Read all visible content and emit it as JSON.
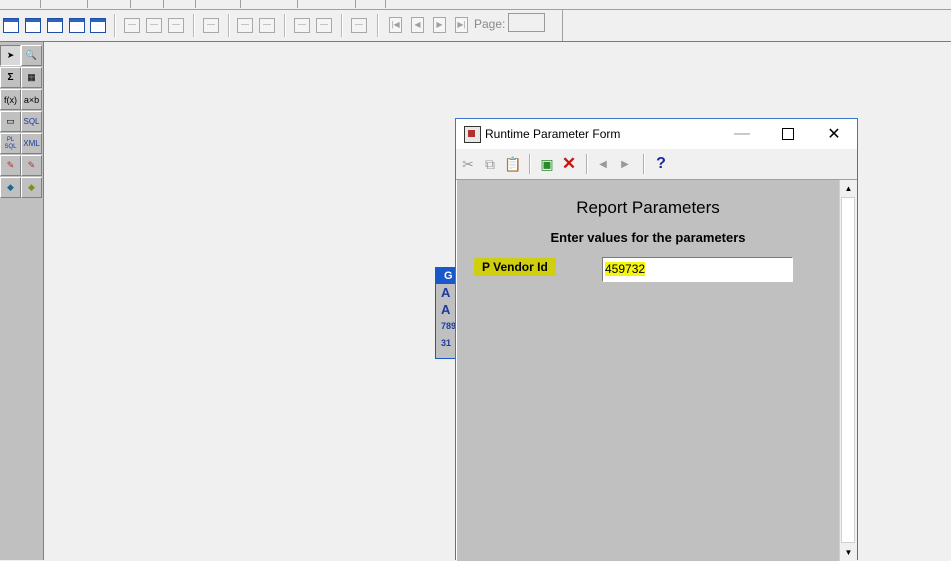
{
  "toolbar": {
    "page_label": "Page:",
    "page_value": ""
  },
  "frame_palette": {
    "header": "G",
    "items": [
      "A",
      "A",
      "789",
      "31"
    ]
  },
  "palette": {
    "labels": {
      "sum": "Σ",
      "func": "f(x)",
      "axb": "a×b",
      "sql": "SQL",
      "plsql": "PL SQL",
      "xml": "XML"
    }
  },
  "dialog": {
    "title": "Runtime Parameter Form",
    "heading": "Report Parameters",
    "subheading": "Enter values for the parameters",
    "parameter": {
      "label": "P Vendor Id",
      "value": "459732"
    },
    "help_glyph": "?"
  },
  "colors": {
    "accent_blue": "#1a57c9",
    "highlight_yellow": "#f5f510",
    "label_olive": "#cfcf10",
    "form_gray": "#c0c0c0"
  }
}
